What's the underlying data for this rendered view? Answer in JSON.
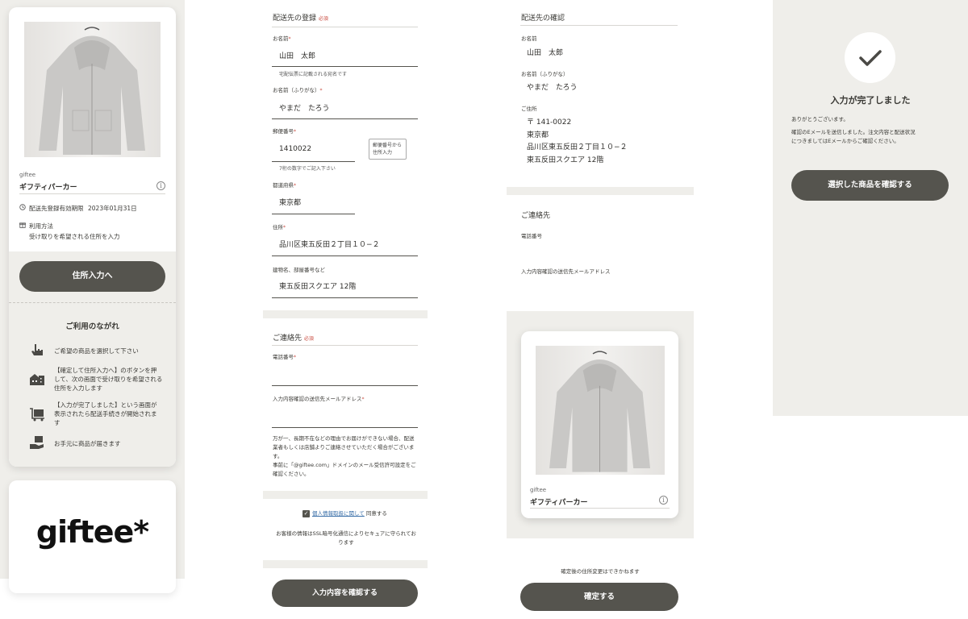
{
  "product": {
    "brand": "giftee",
    "name": "ギフティパーカー",
    "info_icon": "i"
  },
  "panel1": {
    "deadline_label": "配送先登録有効期限",
    "deadline_date": "2023年01月31日",
    "usage_label": "利用方法",
    "usage_text": "受け取りを希望される住所を入力",
    "cta": "住所入力へ",
    "flow_title": "ご利用のながれ",
    "flow_steps": [
      {
        "icon": "hand-pointer-icon",
        "lines": [
          "ご希望の商品を選択して下さい"
        ]
      },
      {
        "icon": "house-icon",
        "lines": [
          "【確定して住所入力へ】のボタンを押",
          "して、次の画面で受け取りを希望される",
          "住所を入力します"
        ]
      },
      {
        "icon": "delivery-cart-icon",
        "lines": [
          "【入力が完了しました】という画面が",
          "表示されたら配送手続きが開始されま",
          "す"
        ]
      },
      {
        "icon": "hand-box-icon",
        "lines": [
          "お手元に商品が届きます"
        ]
      }
    ],
    "logo": "giftee*"
  },
  "form": {
    "section_title": "配送先の登録",
    "required": "必須",
    "name_label": "お名前",
    "name_value": "山田　太郎",
    "name_help": "宅配伝票に記載される宛名です",
    "kana_label": "お名前（ふりがな）",
    "kana_value": "やまだ　たろう",
    "zip_label": "郵便番号",
    "zip_value": "1410022",
    "zip_help": "7桁の数字でご記入下さい",
    "zip_button": [
      "郵便番号から",
      "住所入力"
    ],
    "pref_label": "都道府県",
    "pref_value": "東京都",
    "addr_label": "住所",
    "addr_value": "品川区東五反田２丁目１０−２",
    "bldg_label": "建物名、部屋番号など",
    "bldg_value": "東五反田スクエア 12階",
    "contact_title": "ご連絡先",
    "phone_label": "電話番号",
    "email_label": "入力内容確認の送信先メールアドレス",
    "notice": [
      "万が一、長期不在などの理由でお届けができない場合、配送",
      "業者もしくは店舗よりご連絡させていただく場合がございま",
      "す。",
      "事前に「@giftee.com」ドメインのメール受信許可設定をご",
      "確認ください。"
    ],
    "privacy_link": "個人情報取扱に関して",
    "privacy_agree": "同意する",
    "ssl_note": [
      "お客様の情報はSSL暗号化通信によりセキュアに守られてお",
      "ります"
    ],
    "submit": "入力内容を確認する"
  },
  "confirm": {
    "title": "配送先の確認",
    "name_label": "お名前",
    "name_value": "山田　太郎",
    "kana_label": "お名前（ふりがな）",
    "kana_value": "やまだ　たろう",
    "addr_label": "ご住所",
    "addr_lines": [
      "〒 141-0022",
      "東京都",
      "品川区東五反田２丁目１０−２",
      "東五反田スクエア 12階"
    ],
    "contact_title": "ご連絡先",
    "phone_label": "電話番号",
    "email_label": "入力内容確認の送信先メールアドレス",
    "note": "確定後の住所変更はできかねます",
    "button": "確定する"
  },
  "complete": {
    "check_icon": "check-icon",
    "title": "入力が完了しました",
    "thanks": "ありがとうございます。",
    "message": [
      "確認のEメールを送信しました。注文内容と配送状況",
      "につきましてはEメールからご確認ください。"
    ],
    "button": "選択した商品を確認する"
  }
}
